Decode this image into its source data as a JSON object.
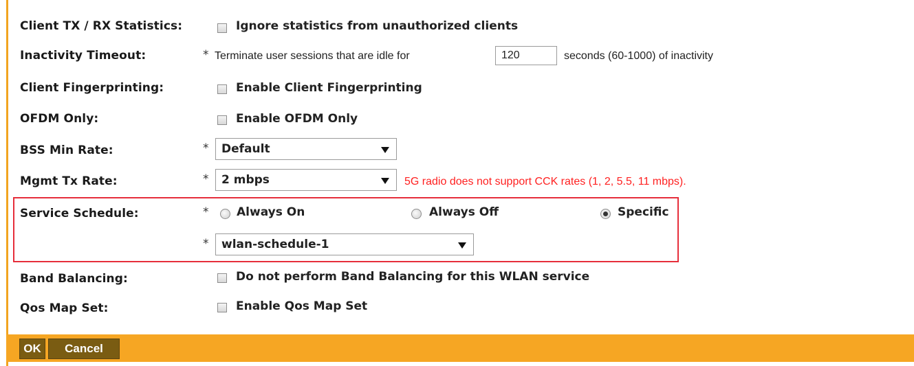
{
  "form": {
    "client_stats": {
      "label": "Client TX / RX Statistics:",
      "checkbox_text": "Ignore statistics from unauthorized clients",
      "checked": false
    },
    "inactivity": {
      "label": "Inactivity Timeout:",
      "star": "*",
      "prefix": "Terminate user sessions that are idle for",
      "value": "120",
      "suffix": "seconds (60-1000) of inactivity"
    },
    "fingerprinting": {
      "label": "Client Fingerprinting:",
      "checkbox_text": "Enable Client Fingerprinting",
      "checked": false
    },
    "ofdm": {
      "label": "OFDM Only:",
      "checkbox_text": "Enable OFDM Only",
      "checked": false
    },
    "bss_min_rate": {
      "label": "BSS Min Rate:",
      "star": "*",
      "selected": "Default"
    },
    "mgmt_tx_rate": {
      "label": "Mgmt Tx Rate:",
      "star": "*",
      "selected": "2 mbps",
      "error": "5G radio does not support CCK rates (1, 2, 5.5, 11 mbps)."
    },
    "service_schedule": {
      "label": "Service Schedule:",
      "star": "*",
      "options": [
        "Always On",
        "Always Off",
        "Specific"
      ],
      "selected_option": "Specific",
      "schedule_star": "*",
      "schedule_selected": "wlan-schedule-1"
    },
    "band_balancing": {
      "label": "Band Balancing:",
      "checkbox_text": "Do not perform Band Balancing for this WLAN service",
      "checked": false
    },
    "qos_map": {
      "label": "Qos Map Set:",
      "checkbox_text": "Enable Qos Map Set",
      "checked": false
    }
  },
  "footer": {
    "ok_label": "OK",
    "cancel_label": "Cancel"
  },
  "colors": {
    "accent": "#f6a623",
    "error": "#ff2020",
    "highlight": "#e62d3a"
  }
}
